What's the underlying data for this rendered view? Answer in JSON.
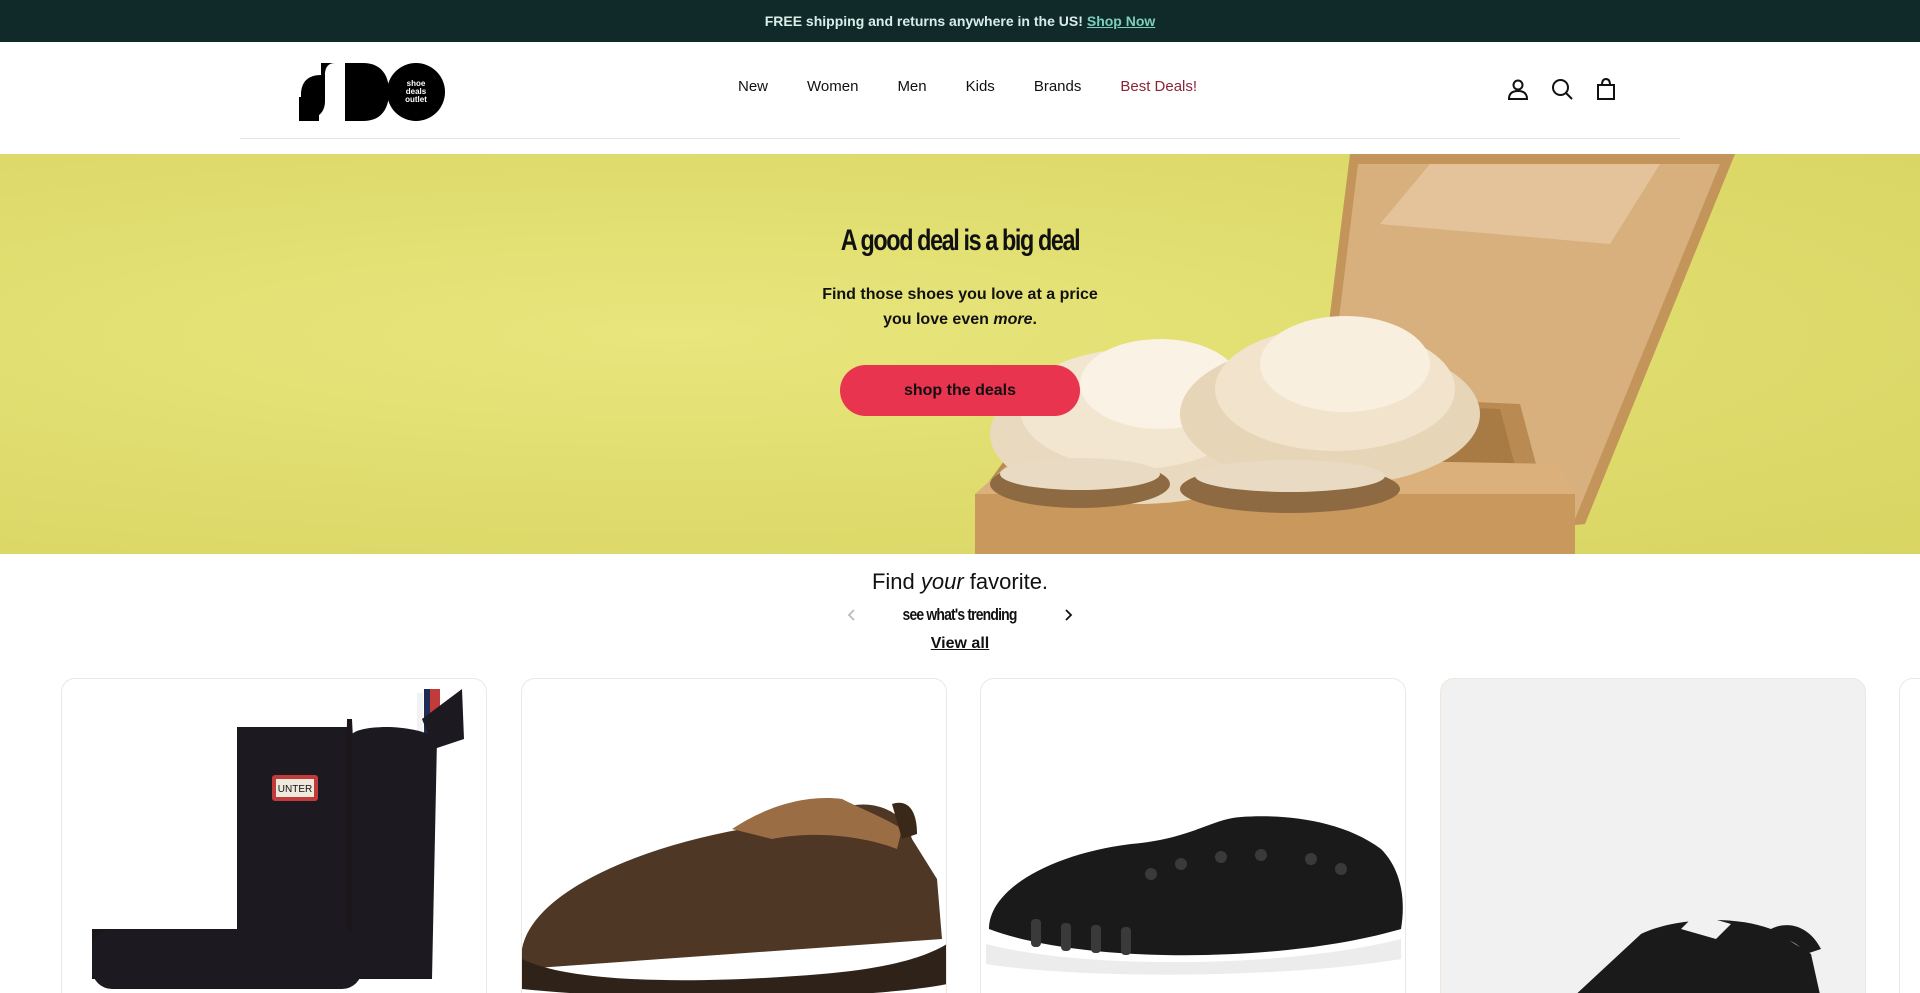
{
  "announcement": {
    "text": "FREE shipping and returns anywhere in the US!",
    "link": "Shop Now"
  },
  "header": {
    "logo_text": "shoe deals outlet",
    "nav": [
      {
        "label": "New"
      },
      {
        "label": "Women"
      },
      {
        "label": "Men"
      },
      {
        "label": "Kids"
      },
      {
        "label": "Brands"
      },
      {
        "label": "Best Deals!"
      }
    ],
    "icons": [
      "account-icon",
      "search-icon",
      "cart-icon"
    ]
  },
  "hero": {
    "title": "A good deal is a big deal",
    "subtitle_part1": "Find those shoes you love at a price you love even ",
    "subtitle_em": "more",
    "subtitle_end": ".",
    "button": "shop the deals",
    "background_color": "#e2df72",
    "button_color": "#e8344e"
  },
  "trending": {
    "title_part1": "Find ",
    "title_em": "your",
    "title_part2": " favorite.",
    "label": "see what's trending",
    "view_all": "View all"
  },
  "products": [
    {
      "name": "black rain boot",
      "image": "black-rain-boot"
    },
    {
      "name": "brown slip-on garden shoe",
      "image": "brown-garden-shoe"
    },
    {
      "name": "black boat shoe",
      "image": "black-boat-shoe"
    },
    {
      "name": "black strap sandal",
      "image": "black-sandal"
    }
  ],
  "colors": {
    "announcement_bg": "#0f2a28",
    "link_color": "#7ccfc0",
    "deals_nav_color": "#8b2337"
  }
}
